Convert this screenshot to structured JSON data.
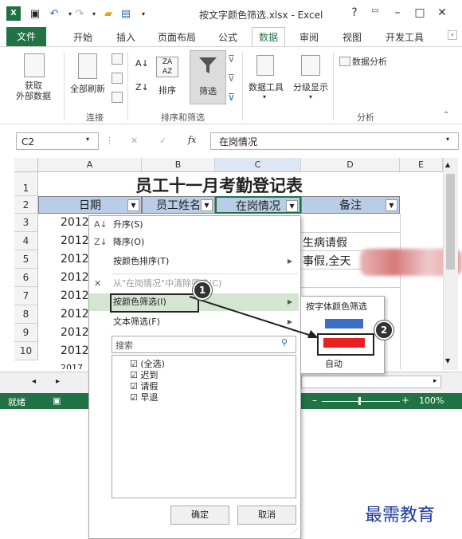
{
  "window": {
    "title": "按文字颜色筛选.xlsx - Excel",
    "help": "?",
    "restore_icon": "ribbon-display-icon",
    "min": "–",
    "max": "□",
    "close": "✕"
  },
  "tabs": [
    "文件",
    "开始",
    "插入",
    "页面布局",
    "公式",
    "数据",
    "审阅",
    "视图",
    "开发工具"
  ],
  "active_tab": "数据",
  "ribbon": {
    "get_external": "获取\n外部数据",
    "refresh_all": "全部刷新",
    "sort": "排序",
    "filter": "筛选",
    "data_tools": "数据工具",
    "outline": "分级显示",
    "data_analysis": "数据分析",
    "group_connections": "连接",
    "group_sort_filter": "排序和筛选",
    "group_analysis": "分析"
  },
  "formula_bar": {
    "name_box": "C2",
    "fx": "fx",
    "cancel": "✕",
    "enter": "✓",
    "content": "在岗情况"
  },
  "sheet": {
    "columns": [
      "A",
      "B",
      "C",
      "D",
      "E"
    ],
    "rows": [
      "1",
      "2",
      "3",
      "4",
      "5",
      "6",
      "7",
      "8",
      "9",
      "10"
    ],
    "title": "员工十一月考勤登记表",
    "headers": [
      "日期",
      "员工姓名",
      "在岗情况",
      "备注"
    ],
    "dates": [
      "2012",
      "2012",
      "2012",
      "2012",
      "2012",
      "2012",
      "2012",
      "2012",
      "2017"
    ],
    "notes": {
      "r4": "生病请假",
      "r5": "事假,全天"
    }
  },
  "menu": {
    "items": [
      {
        "icon": "A↓",
        "label": "升序(S)"
      },
      {
        "icon": "Z↓",
        "label": "降序(O)"
      },
      {
        "icon": "",
        "label": "按颜色排序(T)",
        "arrow": true
      },
      {
        "icon": "✕",
        "label": "从\"在岗情况\"中清除筛选(C)",
        "disabled": true
      },
      {
        "icon": "",
        "label": "按颜色筛选(I)",
        "arrow": true,
        "highlight": true
      },
      {
        "icon": "",
        "label": "文本筛选(F)",
        "arrow": true
      }
    ],
    "search_placeholder": "搜索",
    "checklist": [
      "(全选)",
      "迟到",
      "请假",
      "早退"
    ],
    "ok": "确定",
    "cancel": "取消"
  },
  "submenu": {
    "title": "按字体颜色筛选",
    "colors": [
      "#3a6fc4",
      "#e8201f"
    ],
    "auto": "自动"
  },
  "callouts": [
    "1",
    "2"
  ],
  "status": {
    "ready": "就绪",
    "zoom": "100%"
  },
  "watermark": "最需教育"
}
